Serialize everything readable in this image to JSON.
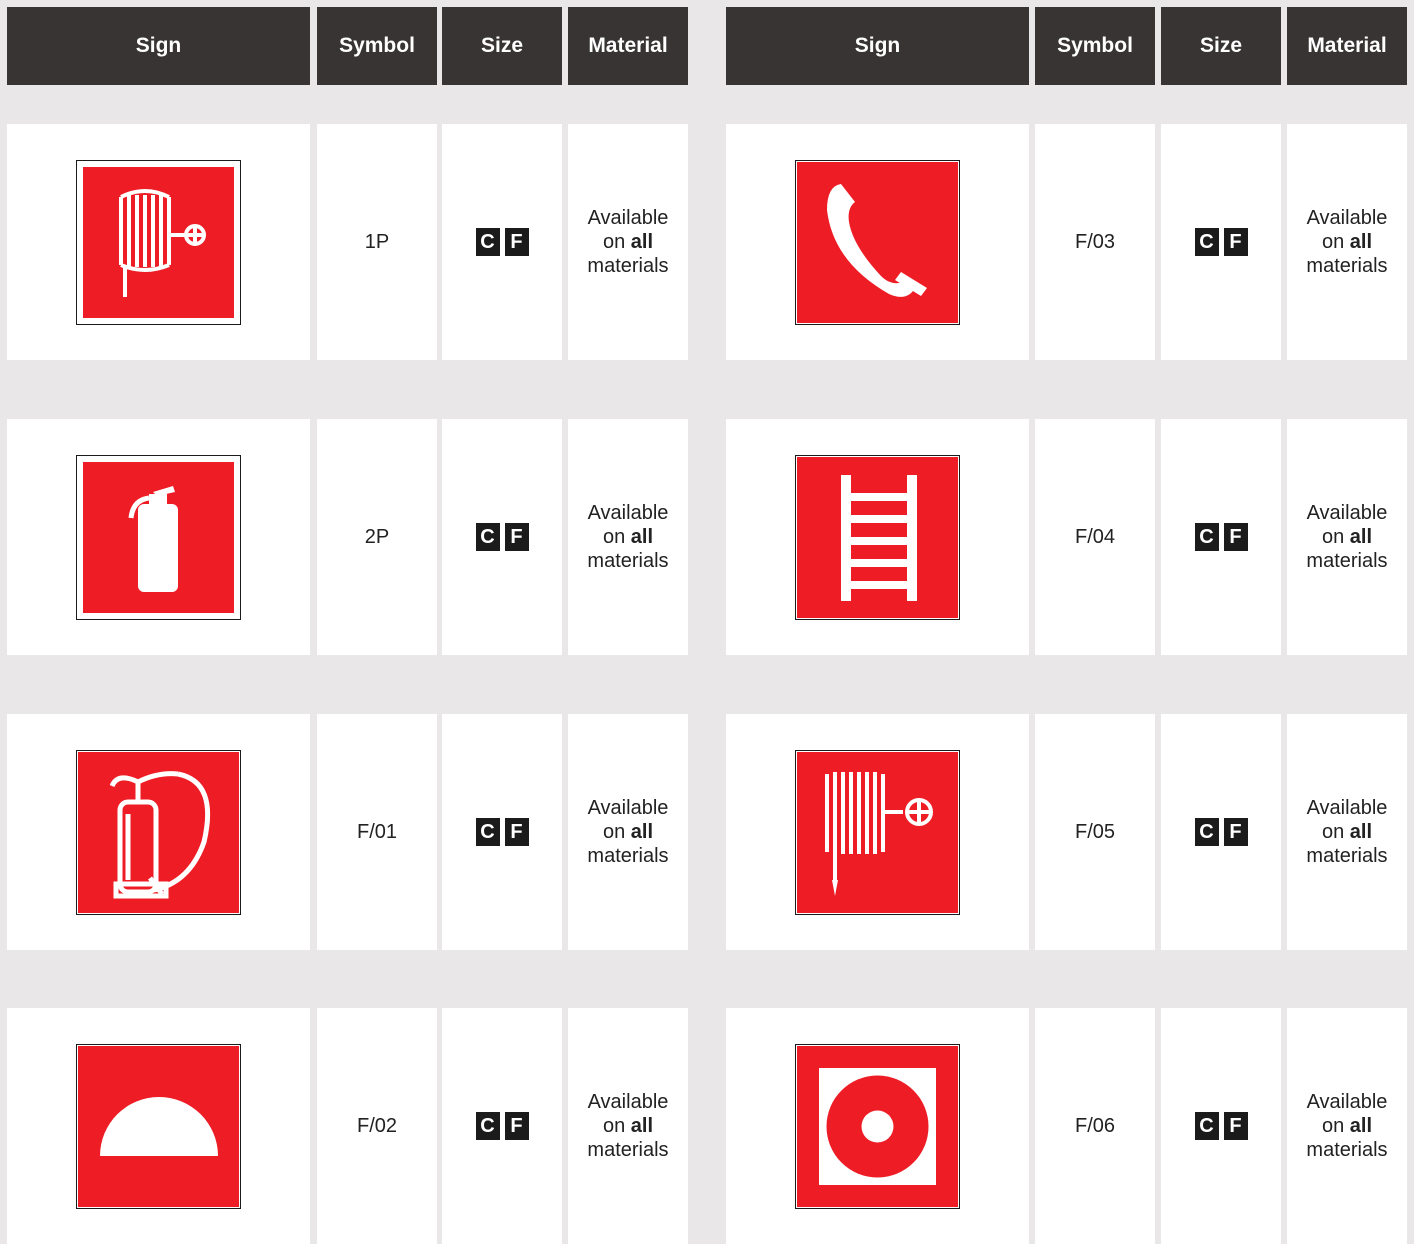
{
  "columns": [
    "Sign",
    "Symbol",
    "Size",
    "Material"
  ],
  "brand_red": "#ee1c25",
  "material_text": {
    "pre": "Available\non ",
    "bold": "all",
    "post": "\nmaterials"
  },
  "left_rows": [
    {
      "icon": "fire-hose-reel-icon",
      "symbol": "1P",
      "sizes": [
        "C",
        "F"
      ]
    },
    {
      "icon": "fire-extinguisher-icon",
      "symbol": "2P",
      "sizes": [
        "C",
        "F"
      ]
    },
    {
      "icon": "fire-extinguisher-hose-icon",
      "symbol": "F/01",
      "sizes": [
        "C",
        "F"
      ]
    },
    {
      "icon": "fire-dome-icon",
      "symbol": "F/02",
      "sizes": [
        "C",
        "F"
      ]
    }
  ],
  "right_rows": [
    {
      "icon": "emergency-phone-icon",
      "symbol": "F/03",
      "sizes": [
        "C",
        "F"
      ]
    },
    {
      "icon": "fire-ladder-icon",
      "symbol": "F/04",
      "sizes": [
        "C",
        "F"
      ]
    },
    {
      "icon": "fire-hose-reel-icon",
      "symbol": "F/05",
      "sizes": [
        "C",
        "F"
      ]
    },
    {
      "icon": "fire-alarm-button-icon",
      "symbol": "F/06",
      "sizes": [
        "C",
        "F"
      ]
    }
  ]
}
